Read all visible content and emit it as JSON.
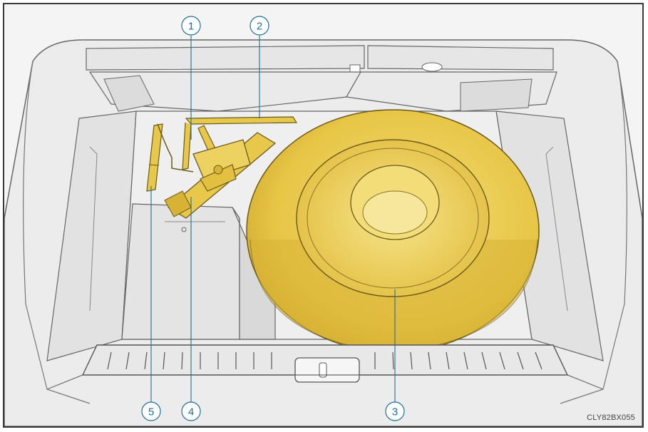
{
  "figure": {
    "code": "CLY82BX055",
    "callout_color": "#1f6f9c",
    "part_color": "#e8c84a",
    "outline_color": "#555555",
    "background_color": "#f3f3f3"
  },
  "callouts": [
    {
      "id": "1",
      "label": "1"
    },
    {
      "id": "2",
      "label": "2"
    },
    {
      "id": "3",
      "label": "3"
    },
    {
      "id": "4",
      "label": "4"
    },
    {
      "id": "5",
      "label": "5"
    }
  ]
}
